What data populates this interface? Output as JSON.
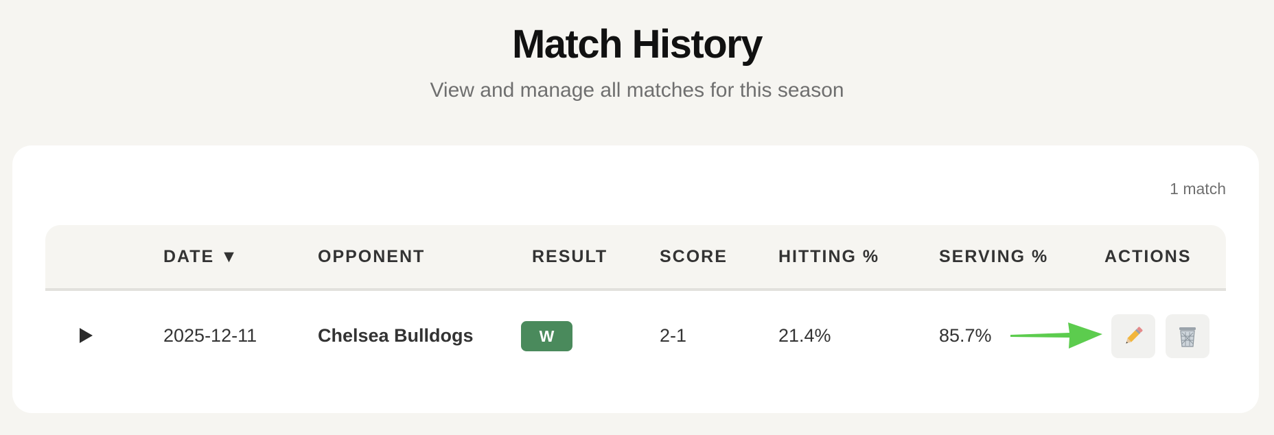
{
  "header": {
    "title": "Match History",
    "subtitle": "View and manage all matches for this season"
  },
  "summary": {
    "count_label": "1 match"
  },
  "table": {
    "columns": [
      "DATE ▼",
      "OPPONENT",
      "RESULT",
      "SCORE",
      "HITTING %",
      "SERVING %",
      "ACTIONS"
    ],
    "sort": {
      "column": "DATE",
      "direction": "descending"
    },
    "rows": [
      {
        "date": "2025-12-11",
        "opponent": "Chelsea Bulldogs",
        "result": "W",
        "score": "2-1",
        "hitting": "21.4%",
        "serving": "85.7%"
      }
    ]
  },
  "icons": {
    "expand": "play-triangle-icon",
    "edit": "pencil-icon",
    "delete": "trash-icon",
    "annotation": "green-arrow-icon"
  },
  "colors": {
    "page_bg": "#f6f5f1",
    "card_bg": "#ffffff",
    "win_badge": "#4a8a5c",
    "annotation_arrow": "#5ccc4e"
  }
}
